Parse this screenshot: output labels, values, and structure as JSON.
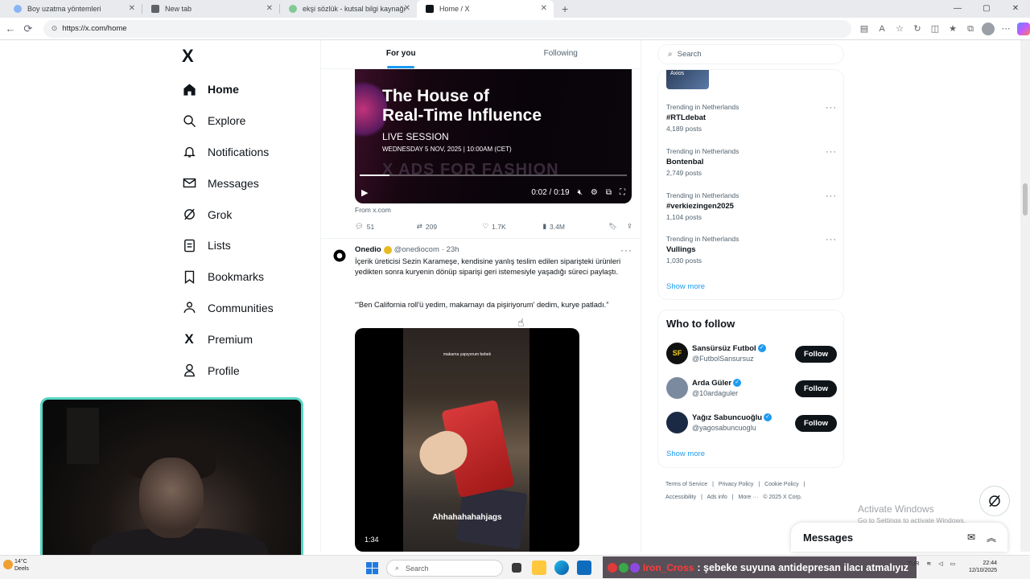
{
  "browser": {
    "tabs": [
      {
        "title": "Boy uzatma yöntemleri",
        "color": "#8ab4f8",
        "active": false
      },
      {
        "title": "New tab",
        "color": "#5f6368",
        "active": false
      },
      {
        "title": "ekşi sözlük - kutsal bilgi kaynağı",
        "color": "#81c995",
        "active": false
      },
      {
        "title": "Home / X",
        "color": "#0f1419",
        "active": true
      }
    ],
    "url": "https://x.com/home",
    "window_controls": [
      "—",
      "▢",
      "✕"
    ]
  },
  "nav": {
    "logo": "X",
    "items": [
      {
        "label": "Home",
        "icon": "home-icon",
        "active": true
      },
      {
        "label": "Explore",
        "icon": "search-icon"
      },
      {
        "label": "Notifications",
        "icon": "bell-icon"
      },
      {
        "label": "Messages",
        "icon": "envelope-icon"
      },
      {
        "label": "Grok",
        "icon": "grok-icon"
      },
      {
        "label": "Lists",
        "icon": "list-icon"
      },
      {
        "label": "Bookmarks",
        "icon": "bookmark-icon"
      },
      {
        "label": "Communities",
        "icon": "communities-icon"
      },
      {
        "label": "Premium",
        "icon": "x-premium-icon"
      },
      {
        "label": "Profile",
        "icon": "person-icon"
      }
    ]
  },
  "feed": {
    "tabs": [
      "For you",
      "Following"
    ],
    "post1": {
      "video": {
        "title_line1": "The House of",
        "title_line2": "Real-Time Influence",
        "subtitle": "LIVE SESSION",
        "date": "WEDNESDAY 5 NOV, 2025 | 10:00AM (CET)",
        "faded": "X ADS FOR FASHION",
        "time": "0:02 / 0:19",
        "progress": 0.11
      },
      "source": "From x.com",
      "replies": "51",
      "reposts": "209",
      "likes": "1.7K",
      "views": "3.4M"
    },
    "post2": {
      "name": "Onedio",
      "handle": "@onediocom",
      "time": "· 23h",
      "text": "İçerik üreticisi Sezin Karameşe, kendisine yanlış teslim edilen siparişteki ürünleri yedikten sonra kuryenin dönüp siparişi geri istemesiyle yaşadığı süreci paylaştı.",
      "quote": "“'Ben California roll'ü yedim, makarnayı da pişiriyorum' dedim, kurye patladı.”",
      "video_caption": "Ahhahahahahjags",
      "video_top_caption": "makarna yapıyorum bebek",
      "duration": "1:34"
    }
  },
  "right": {
    "search_placeholder": "Search",
    "trend_thumb": "Axios",
    "trends": [
      {
        "context": "Trending in Netherlands",
        "name": "#RTLdebat",
        "count": "4,189 posts"
      },
      {
        "context": "Trending in Netherlands",
        "name": "Bontenbal",
        "count": "2,749 posts"
      },
      {
        "context": "Trending in Netherlands",
        "name": "#verkiezingen2025",
        "count": "1,104 posts"
      },
      {
        "context": "Trending in Netherlands",
        "name": "Vullings",
        "count": "1,030 posts"
      }
    ],
    "show_more": "Show more",
    "who_to_follow": {
      "title": "Who to follow",
      "accounts": [
        {
          "name": "Sansürsüz Futbol",
          "handle": "@FutbolSansursuz",
          "avatar_color": "#111111",
          "avatar_text": "SF"
        },
        {
          "name": "Arda Güler",
          "handle": "@10ardaguler",
          "avatar_color": "#7c8aa0",
          "avatar_text": ""
        },
        {
          "name": "Yağız Sabuncuoğlu",
          "handle": "@yagosabuncuoglu",
          "avatar_color": "#1b2a44",
          "avatar_text": ""
        }
      ],
      "follow_label": "Follow",
      "show_more": "Show more"
    },
    "footer": [
      "Terms of Service",
      "|",
      "Privacy Policy",
      "|",
      "Cookie Policy",
      "|",
      "Accessibility",
      "|",
      "Ads info",
      "|",
      "More ···",
      "© 2025 X Corp."
    ]
  },
  "overlay": {
    "activate_title": "Activate Windows",
    "activate_sub": "Go to Settings to activate Windows.",
    "messages_title": "Messages"
  },
  "taskbar": {
    "weather_temp": "14°C",
    "weather_desc": "Deels",
    "search": "Search",
    "chat_user": "Iron_Cross",
    "chat_msg": ": şebeke suyuna antidepresan ilacı atmalıyız",
    "lang": "TUR",
    "time": "22:44",
    "date": "12/10/2025"
  }
}
